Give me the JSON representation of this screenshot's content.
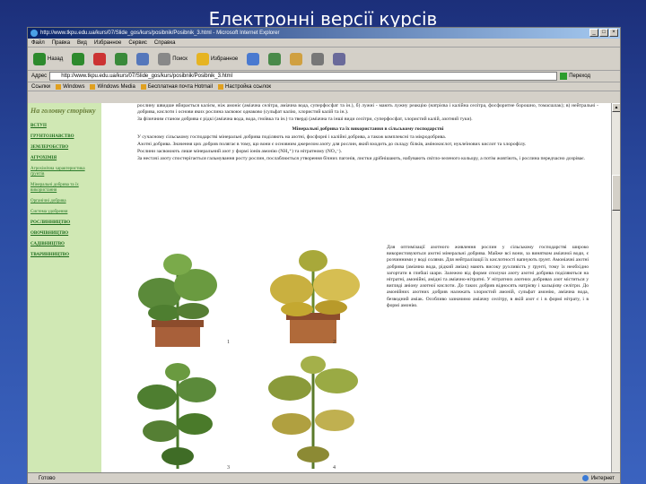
{
  "slide": {
    "title": "Електронні версії курсів"
  },
  "browser": {
    "window_title": "http://www.tkpu.edu.ua/kurs/07/Slide_gos/kurs/posibnik/Posibnik_3.html - Microsoft Internet Explorer",
    "menu": [
      "Файл",
      "Правка",
      "Вид",
      "Избранное",
      "Сервис",
      "Справка"
    ],
    "toolbar": [
      {
        "label": "Назад",
        "icon": "back-arrow-icon",
        "color": "#2d8a2d"
      },
      {
        "label": "",
        "icon": "forward-arrow-icon",
        "color": "#2d8a2d"
      },
      {
        "label": "",
        "icon": "stop-icon",
        "color": "#cc3333"
      },
      {
        "label": "",
        "icon": "refresh-icon",
        "color": "#3a8a3a"
      },
      {
        "label": "",
        "icon": "home-icon",
        "color": "#5577bb"
      },
      {
        "label": "Поиск",
        "icon": "search-icon",
        "color": "#888888"
      },
      {
        "label": "Избранное",
        "icon": "favorites-icon",
        "color": "#e6b422"
      },
      {
        "label": "",
        "icon": "media-icon",
        "color": "#4a7ad0"
      },
      {
        "label": "",
        "icon": "history-icon",
        "color": "#4a8a4a"
      },
      {
        "label": "",
        "icon": "mail-icon",
        "color": "#d0a040"
      },
      {
        "label": "",
        "icon": "print-icon",
        "color": "#777777"
      },
      {
        "label": "",
        "icon": "edit-icon",
        "color": "#6a6a9a"
      }
    ],
    "address_label": "Адрес",
    "address_value": "http://www.tkpu.edu.ua/kurs/07/Slide_gos/kurs/posibnik/Posibnik_3.html",
    "go_label": "Переход",
    "links_label": "Ссылки",
    "links": [
      "Windows",
      "Windows Media",
      "Бесплатная почта Hotmail",
      "Настройка ссылок"
    ],
    "status_left": "Готово",
    "status_zone": "Интернет"
  },
  "sidebar": {
    "title": "На головну сторінку",
    "items": [
      {
        "label": "ВСТУП",
        "small": false
      },
      {
        "label": "ГРУНТОЗНАВСТВО",
        "small": false
      },
      {
        "label": "ЗЕМЛЕРОБСТВО",
        "small": false
      },
      {
        "label": "АГРОХІМІЯ",
        "small": false
      },
      {
        "label": "Агрохімічна характеристика ґрунтів",
        "small": true
      },
      {
        "label": "Мінеральні добрива та їх використання",
        "small": true
      },
      {
        "label": "Органічні добрива",
        "small": true
      },
      {
        "label": "Система удобрення",
        "small": true
      },
      {
        "label": "РОСЛИННИЦТВО",
        "small": false
      },
      {
        "label": "ОВОЧІВНИЦТВО",
        "small": false
      },
      {
        "label": "САДІВНИЦТВО",
        "small": false
      },
      {
        "label": "ТВАРИННИЦТВО",
        "small": false
      }
    ]
  },
  "content": {
    "intro": [
      "рослину швидше вбирається калієм, ніж амоніє (аміачна селітра, аміачна вода, суперфосфат та ін.), б) лужні - мають лужну реакцію (натрієва і калійна селітра, фосфоритне борошно, томасшлак); в) нейтральні - добрива, кислоти і основи яких рослина засвоює однаково (сульфат калію, хлористий калій та ін.).",
      "За фізичним станом добрива є рідкі (аміачна вода, вода, гноївка та ін.) та тверді (аміачна та інші види селітри, суперфосфат, хлористий калій, азотний туки)."
    ],
    "section_title": "Мінеральні добрива та їх використання в сільському господарстві",
    "body": [
      "У сучасному сільському господарстві мінеральні добрива поділяють на азотні, фосфорні і калійні добрива, а також комплексні та мікродобрива.",
      "Азотні добрива. Значення цих добрив полягає в тому, що вони є основним джерелом азоту для рослин, який входить до складу білків, амінокислот, нуклеїнових кислот та хлорофілу.",
      "Рослини засвоюють лише мінеральний азот у формі іонів амонію (NH₄⁺) та нітратному (NO₃⁻).",
      "За нестачі азоту спостерігається гальмування росту рослин, послаблюється утворення бічних пагонів, листки дрібнішають, набувають світло-зеленого кольору, а потім жовтіють, і рослина передчасно дозріває."
    ],
    "right_col": "Для оптимізації азотного живлення рослин у сільському господарстві широко використовуються азотні мінеральні добрива. Майже всі вони, за винятком аміачної води, є розчинними у воді солями. Для нейтралізації їх кислотності вапнують ґрунт. Амоніачні азотні добрива (аміачна вода, рідкий аміак) мають високу рухливість у ґрунті, тому їх необхідно загортати в глибші шари. Залежно від форми сполуки азоту азотні добрива поділяються на нітратні, амонійні, амідні та аміачно-нітратні. У нітратних азотних добривах азот міститься у вигляді аніону азотної кислоти. До таких добрив відносять натрієву і кальцієву селітри. До амонійних азотних добрив належать хлористий амоній, сульфат амонію, аміачна вода, безводний аміак. Особливо зазначимо аміачну селітру, в якій азот є і в формі нітрату, і в формі амонію.",
    "figure_labels": [
      "1",
      "2",
      "3",
      "4"
    ]
  },
  "colors": {
    "slide_bg": "#2a4aa0",
    "sidebar_bg": "#d0e8b4",
    "sidebar_link": "#1a6a1a",
    "title_bar": "#0a246a"
  }
}
